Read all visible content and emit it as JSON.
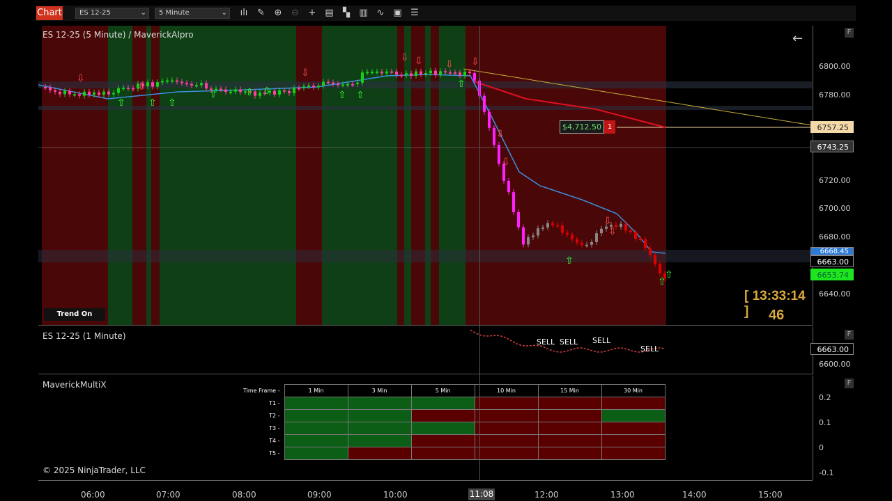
{
  "toolbar": {
    "tab": "Chart",
    "instrument": "ES 12-25",
    "interval": "5 Minute",
    "icons": [
      "bar-type-icon",
      "pencil-icon",
      "zoom-in-icon",
      "zoom-out-icon",
      "crosshair-icon",
      "data-box-icon",
      "properties-icon",
      "indicators-icon",
      "strategies-icon",
      "templates-icon",
      "list-icon"
    ]
  },
  "main": {
    "title": "ES 12-25 (5 Minute) / MaverickAIpro",
    "trend_label": "Trend On",
    "pnl": "$4,712.50",
    "qty": "1",
    "timer": "[ 13:33:14 ]",
    "timer_count": "46",
    "ticks": [
      "6800.00",
      "6780.00",
      "6720.00",
      "6700.00",
      "6680.00",
      "6640.00"
    ],
    "price_labels": {
      "target": "6757.25",
      "current_line": "6743.25",
      "blue": "6668.45",
      "last": "6663.00",
      "green": "6653.74"
    }
  },
  "panel2": {
    "title": "ES 12-25 (1 Minute)",
    "last": "6663.00",
    "tick": "6600.00",
    "sell": "SELL"
  },
  "panel3": {
    "title": "MaverickMultiX",
    "ticks": [
      "0.2",
      "0.1",
      "0",
      "-0.1"
    ],
    "header_label": "Time Frame -",
    "timeframes": [
      "1 Min",
      "3 Min",
      "5 Min",
      "10 Min",
      "15 Min",
      "30 Min"
    ],
    "rows": [
      {
        "label": "T1 -",
        "states": [
          "up",
          "up",
          "up",
          "down",
          "down",
          "down"
        ]
      },
      {
        "label": "T2 -",
        "states": [
          "up",
          "up",
          "down",
          "down",
          "down",
          "up"
        ]
      },
      {
        "label": "T3 -",
        "states": [
          "up",
          "up",
          "up",
          "down",
          "down",
          "down"
        ]
      },
      {
        "label": "T4 -",
        "states": [
          "up",
          "up",
          "down",
          "down",
          "down",
          "down"
        ]
      },
      {
        "label": "T5 -",
        "states": [
          "up",
          "down",
          "down",
          "down",
          "down",
          "down"
        ]
      }
    ]
  },
  "copyright": "© 2025 NinjaTrader, LLC",
  "time_axis": [
    "06:00",
    "07:00",
    "08:00",
    "09:00",
    "10:00",
    "12:00",
    "13:00",
    "14:00",
    "15:00"
  ],
  "crosshair_time": "11:08",
  "colors": {
    "up": "#0c5e16",
    "down": "#5a0000",
    "accent": "#d0321e"
  }
}
